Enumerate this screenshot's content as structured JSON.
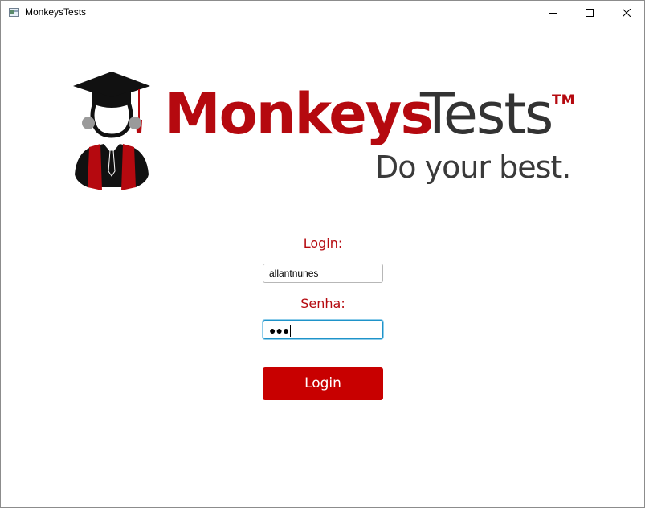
{
  "window": {
    "title": "MonkeysTests",
    "icon": "app-window-icon",
    "controls": {
      "minimize": "minimize-icon",
      "maximize": "maximize-icon",
      "close": "close-icon"
    }
  },
  "logo": {
    "brand_primary": "Monkeys",
    "brand_secondary": "Tests",
    "trademark": "TM",
    "tagline": "Do your best.",
    "mascot": "graduate-mascot-icon"
  },
  "form": {
    "login_label": "Login:",
    "login_value": "allantnunes",
    "password_label": "Senha:",
    "password_mask": "●●●",
    "submit_label": "Login"
  },
  "colors": {
    "brand_red": "#b5090f",
    "button_red": "#c80000",
    "text_dark": "#333333",
    "focus_blue": "#1f93c9"
  }
}
